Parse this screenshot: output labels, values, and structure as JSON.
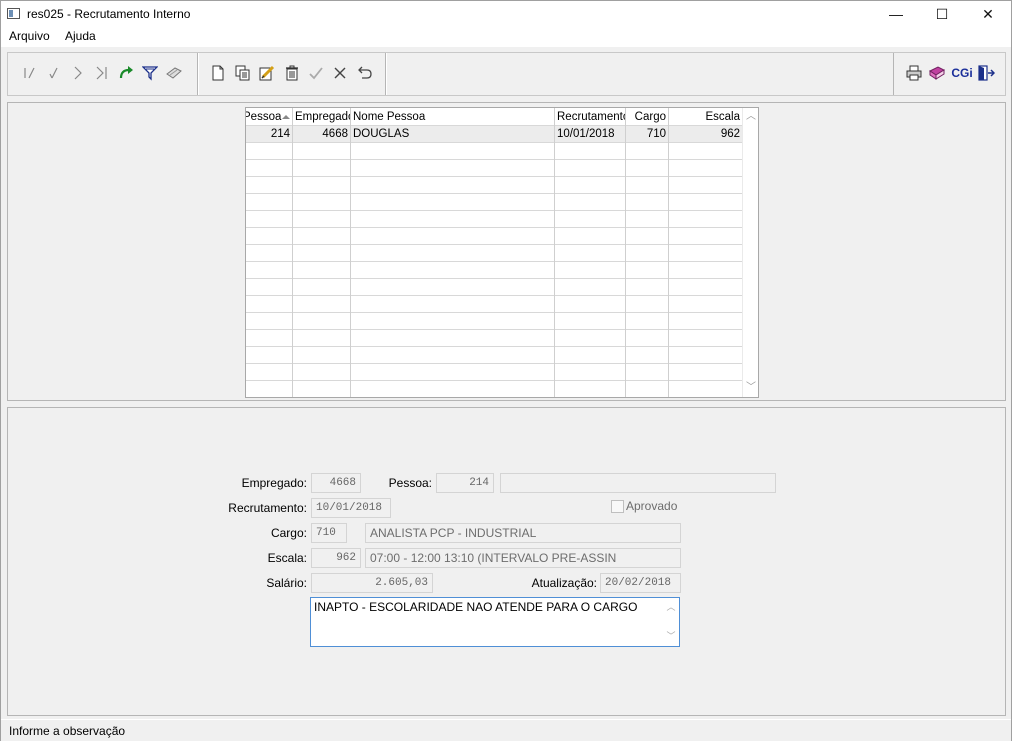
{
  "window": {
    "title": "res025 - Recrutamento Interno",
    "controls": {
      "minimize": "—",
      "maximize": "☐",
      "close": "✕"
    }
  },
  "menu": {
    "items": [
      "Arquivo",
      "Ajuda"
    ]
  },
  "toolbar": {
    "nav_icons": [
      "first-record-icon",
      "previous-record-icon",
      "next-record-icon",
      "last-record-icon",
      "refresh-icon",
      "filter-icon",
      "clear-filter-icon"
    ],
    "edit_icons": [
      "new-icon",
      "copy-icon",
      "edit-icon",
      "delete-icon",
      "confirm-icon",
      "cancel-icon",
      "undo-icon"
    ],
    "extra_icons": [
      "print-icon",
      "book-icon",
      "cgi-icon",
      "exit-icon"
    ],
    "cgi_label": "CGi"
  },
  "grid": {
    "columns": [
      "Pessoa",
      "Empregado",
      "Nome Pessoa",
      "Recrutamento",
      "Cargo",
      "Escala"
    ],
    "rows": [
      [
        "214",
        "4668",
        "DOUGLAS",
        "10/01/2018",
        "710",
        "962"
      ]
    ]
  },
  "form": {
    "empregado_label": "Empregado:",
    "empregado_value": "4668",
    "pessoa_label": "Pessoa:",
    "pessoa_value": "214",
    "pessoa_name": "",
    "recrutamento_label": "Recrutamento:",
    "recrutamento_value": "10/01/2018",
    "aprovado_label": "Aprovado",
    "aprovado_checked": false,
    "cargo_label": "Cargo:",
    "cargo_code": "710",
    "cargo_desc": "ANALISTA PCP - INDUSTRIAL",
    "escala_label": "Escala:",
    "escala_code": "962",
    "escala_desc": "07:00 - 12:00 13:10 (INTERVALO PRE-ASSIN",
    "salario_label": "Salário:",
    "salario_value": "2.605,03",
    "atualizacao_label": "Atualização:",
    "atualizacao_value": "20/02/2018",
    "observacao": "INAPTO - ESCOLARIDADE NAO ATENDE PARA O CARGO"
  },
  "status": {
    "text": "Informe a observação"
  }
}
